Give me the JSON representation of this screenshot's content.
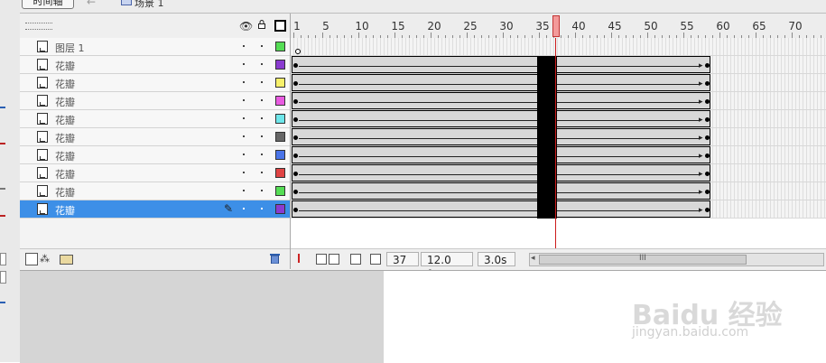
{
  "window": {
    "timeline_tab_label": "时间轴",
    "scene_label": "场景 1"
  },
  "layers": [
    {
      "name": "图层 1",
      "color": "#55dd55",
      "selected": false
    },
    {
      "name": "花瓣",
      "color": "#8a3bd0",
      "selected": false
    },
    {
      "name": "花瓣",
      "color": "#f7f06a",
      "selected": false
    },
    {
      "name": "花瓣",
      "color": "#e85be0",
      "selected": false
    },
    {
      "name": "花瓣",
      "color": "#6ee6ea",
      "selected": false
    },
    {
      "name": "花瓣",
      "color": "#666666",
      "selected": false
    },
    {
      "name": "花瓣",
      "color": "#4a74e8",
      "selected": false
    },
    {
      "name": "花瓣",
      "color": "#e04444",
      "selected": false
    },
    {
      "name": "花瓣",
      "color": "#55dd55",
      "selected": false
    },
    {
      "name": "花瓣",
      "color": "#8a3bd0",
      "selected": true
    }
  ],
  "timeline": {
    "ruler_labels": [
      "1",
      "5",
      "10",
      "15",
      "20",
      "25",
      "30",
      "35",
      "40",
      "45",
      "50",
      "55",
      "60",
      "65",
      "70"
    ],
    "current_frame": "37",
    "frame_rate": "12.0 fps",
    "elapsed_time": "3.0s",
    "scroll_grip": "III",
    "tween_start_frame": 1,
    "tween_end_frame": 58,
    "selected_frames": [
      35,
      37
    ]
  },
  "icons": {
    "eye": "eye-icon",
    "lock": "lock-icon",
    "outline": "outline-icon",
    "pencil": "pencil-icon",
    "add_layer": "add-layer-icon",
    "add_guide": "add-motion-guide-icon",
    "add_folder": "add-folder-icon",
    "trash": "trash-icon"
  },
  "watermark": {
    "brand": "Baidu 经验",
    "url": "jingyan.baidu.com"
  }
}
